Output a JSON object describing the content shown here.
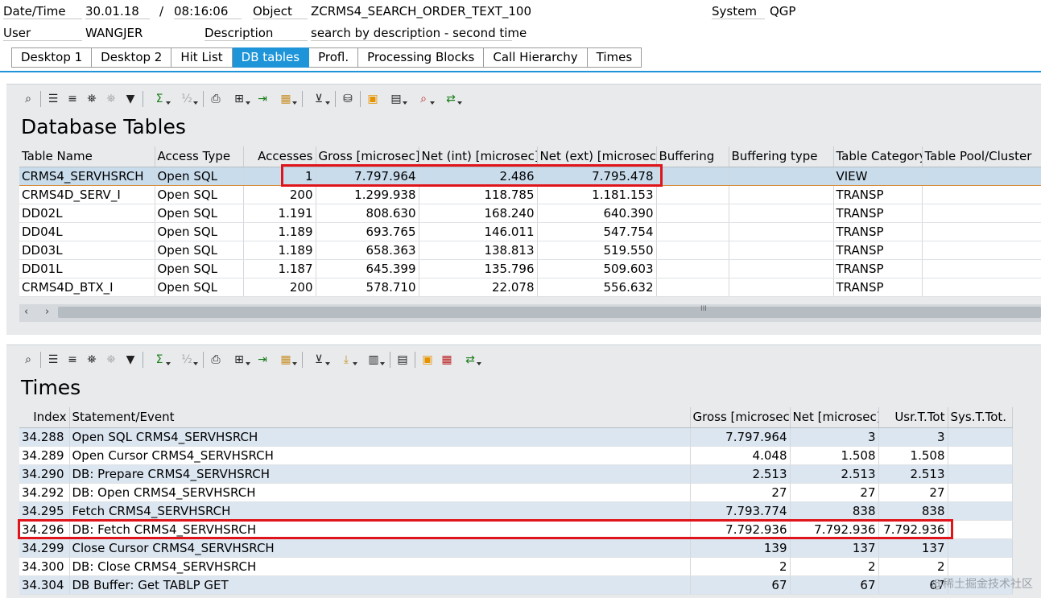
{
  "header": {
    "datetime_label": "Date/Time",
    "date": "30.01.18",
    "slash": "/",
    "time": "08:16:06",
    "object_label": "Object",
    "object_value": "ZCRMS4_SEARCH_ORDER_TEXT_100",
    "system_label": "System",
    "system_value": "QGP",
    "user_label": "User",
    "user_value": "WANGJER",
    "description_label": "Description",
    "description_value": "search by description - second time"
  },
  "tabs": [
    {
      "label": "Desktop 1"
    },
    {
      "label": "Desktop 2"
    },
    {
      "label": "Hit List"
    },
    {
      "label": "DB tables",
      "active": true
    },
    {
      "label": "Profl."
    },
    {
      "label": "Processing Blocks"
    },
    {
      "label": "Call Hierarchy"
    },
    {
      "label": "Times"
    }
  ],
  "db_panel": {
    "title": "Database Tables",
    "columns": [
      "Table Name",
      "Access Type",
      "Accesses",
      "Gross [microsec]",
      "Net (int) [microsec]",
      "Net (ext) [microsec]",
      "Buffering",
      "Buffering type",
      "Table Category",
      "Table Pool/Cluster"
    ],
    "rows": [
      [
        "CRMS4_SERVHSRCH",
        "Open SQL",
        "1",
        "7.797.964",
        "2.486",
        "7.795.478",
        "",
        "",
        "VIEW",
        ""
      ],
      [
        "CRMS4D_SERV_I",
        "Open SQL",
        "200",
        "1.299.938",
        "118.785",
        "1.181.153",
        "",
        "",
        "TRANSP",
        ""
      ],
      [
        "DD02L",
        "Open SQL",
        "1.191",
        "808.630",
        "168.240",
        "640.390",
        "",
        "",
        "TRANSP",
        ""
      ],
      [
        "DD04L",
        "Open SQL",
        "1.189",
        "693.765",
        "146.011",
        "547.754",
        "",
        "",
        "TRANSP",
        ""
      ],
      [
        "DD03L",
        "Open SQL",
        "1.189",
        "658.363",
        "138.813",
        "519.550",
        "",
        "",
        "TRANSP",
        ""
      ],
      [
        "DD01L",
        "Open SQL",
        "1.187",
        "645.399",
        "135.796",
        "509.603",
        "",
        "",
        "TRANSP",
        ""
      ],
      [
        "CRMS4D_BTX_I",
        "Open SQL",
        "200",
        "578.710",
        "22.078",
        "556.632",
        "",
        "",
        "TRANSP",
        ""
      ]
    ],
    "scroll_grip": "III",
    "left_arrow": "‹",
    "right_arrow": "›"
  },
  "times_panel": {
    "title": "Times",
    "columns": [
      "Index",
      "Statement/Event",
      "Gross [microsec]",
      "Net [microsec]",
      "Usr.T.Tot",
      "Sys.T.Tot."
    ],
    "rows": [
      [
        "34.288",
        "Open SQL CRMS4_SERVHSRCH",
        "7.797.964",
        "3",
        "3",
        ""
      ],
      [
        "34.289",
        "Open Cursor CRMS4_SERVHSRCH",
        "4.048",
        "1.508",
        "1.508",
        ""
      ],
      [
        "34.290",
        "DB: Prepare CRMS4_SERVHSRCH",
        "2.513",
        "2.513",
        "2.513",
        ""
      ],
      [
        "34.292",
        "DB: Open CRMS4_SERVHSRCH",
        "27",
        "27",
        "27",
        ""
      ],
      [
        "34.295",
        "Fetch CRMS4_SERVHSRCH",
        "7.793.774",
        "838",
        "838",
        ""
      ],
      [
        "34.296",
        "DB: Fetch CRMS4_SERVHSRCH",
        "7.792.936",
        "7.792.936",
        "7.792.936",
        ""
      ],
      [
        "34.299",
        "Close Cursor CRMS4_SERVHSRCH",
        "139",
        "137",
        "137",
        ""
      ],
      [
        "34.300",
        "DB: Close CRMS4_SERVHSRCH",
        "2",
        "2",
        "2",
        ""
      ],
      [
        "34.304",
        "DB Buffer: Get TABLP GET",
        "67",
        "67",
        "67",
        ""
      ]
    ]
  },
  "watermark": "@稀土掘金技术社区",
  "colors": {
    "accent": "#1e95d8",
    "highlight": "#e0151b",
    "selected_row": "#c9dcec"
  }
}
